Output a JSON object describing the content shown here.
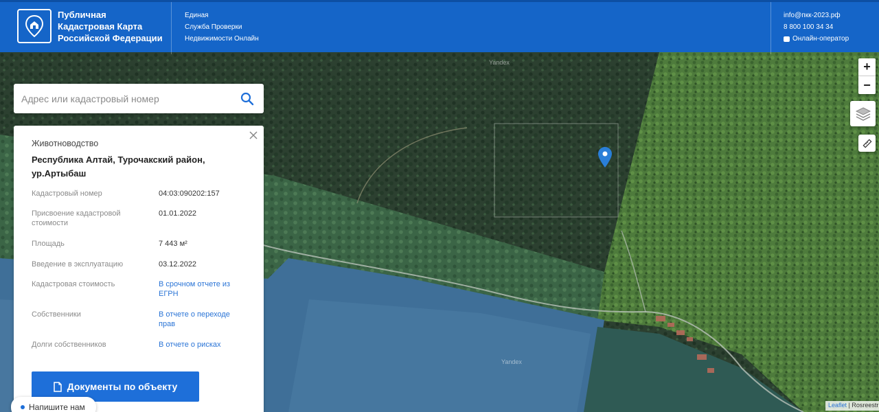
{
  "header": {
    "brand_lines": [
      "Публичная",
      "Кадастровая Карта",
      "Российской Федерации"
    ],
    "service_lines": [
      "Единая",
      "Служба Проверки",
      "Недвижимости Онлайн"
    ],
    "email": "info@пкк-2023.рф",
    "phone": "8 800 100 34 34",
    "operator_label": "Онлайн-оператор",
    "logo_icon": "house-map-pin-icon"
  },
  "search": {
    "placeholder": "Адрес или кадастровый номер",
    "value": "",
    "icon": "search-icon"
  },
  "object_card": {
    "category": "Животноводство",
    "address": "Республика Алтай, Турочакский район, ур.Артыбаш",
    "rows": [
      {
        "label": "Кадастровый номер",
        "value": "04:03:090202:157"
      },
      {
        "label": "Присвоение кадастровой стоимости",
        "value": "01.01.2022"
      },
      {
        "label": "Площадь",
        "value": "7 443 м²"
      },
      {
        "label": "Введение в эксплуатацию",
        "value": "03.12.2022"
      },
      {
        "label": "Кадастровая стоимость",
        "value": "В срочном отчете из ЕГРН"
      },
      {
        "label": "Собственники",
        "value": "В отчете о переходе прав"
      },
      {
        "label": "Долги собственников",
        "value": "В отчете о рисках"
      }
    ],
    "documents_button": "Документы по объекту",
    "close_icon": "close-icon"
  },
  "chat_widget": {
    "label": "Напишите нам"
  },
  "map_controls": {
    "zoom_in": "+",
    "zoom_out": "−",
    "layers_icon": "layers-icon",
    "ruler_icon": "ruler-icon"
  },
  "attribution": {
    "leaflet": "Leaflet",
    "separator": " | ",
    "source": "Rosreestr"
  },
  "map_watermark": "Yandex",
  "colors": {
    "header": "#1565c8",
    "accent": "#1e6fd9",
    "link": "#2a74d6",
    "marker": "#2a7fd8"
  }
}
